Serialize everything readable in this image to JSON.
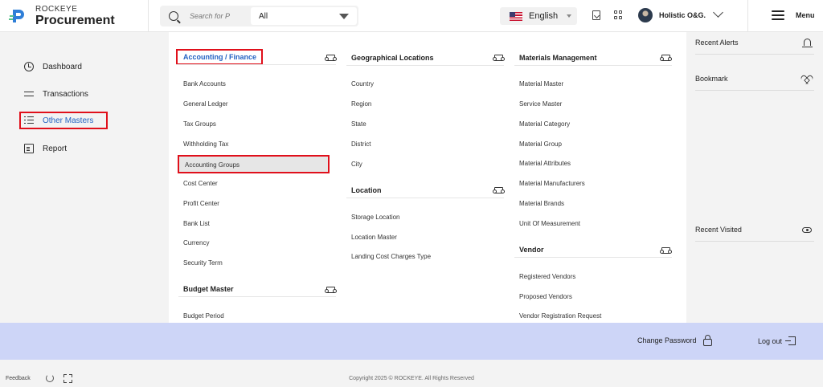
{
  "header": {
    "brand_sub": "ROCKEYE",
    "brand_main": "Procurement",
    "search_placeholder": "Search for P",
    "search_scope": "All",
    "language": "English",
    "user_name": "Holistic O&G.",
    "menu_label": "Menu"
  },
  "sidebar": {
    "items": [
      {
        "label": "Dashboard",
        "icon": "dashboard-icon"
      },
      {
        "label": "Transactions",
        "icon": "transactions-icon"
      },
      {
        "label": "Other Masters",
        "icon": "list-icon",
        "active": true
      },
      {
        "label": "Report",
        "icon": "report-icon"
      }
    ]
  },
  "menu": {
    "accounting": {
      "title": "Accounting / Finance",
      "items": [
        "Bank Accounts",
        "General Ledger",
        "Tax Groups",
        "Withholding Tax",
        "Accounting Groups",
        "Cost Center",
        "Profit Center",
        "Bank List",
        "Currency",
        "Security Term"
      ]
    },
    "budget": {
      "title": "Budget Master",
      "items": [
        "Budget Period"
      ]
    },
    "geo": {
      "title": "Geographical Locations",
      "items": [
        "Country",
        "Region",
        "State",
        "District",
        "City"
      ]
    },
    "location": {
      "title": "Location",
      "items": [
        "Storage Location",
        "Location Master",
        "Landing Cost Charges Type"
      ]
    },
    "materials": {
      "title": "Materials Management",
      "items": [
        "Material Master",
        "Service Master",
        "Material Category",
        "Material Group",
        "Material Attributes",
        "Material Manufacturers",
        "Material Brands",
        "Unit Of Measurement"
      ]
    },
    "vendor": {
      "title": "Vendor",
      "items": [
        "Registered Vendors",
        "Proposed Vendors",
        "Vendor Registration Request"
      ]
    }
  },
  "right_panel": {
    "recent_alerts": "Recent Alerts",
    "bookmark": "Bookmark",
    "recent_visited": "Recent Visited"
  },
  "footer": {
    "change_password": "Change Password",
    "logout": "Log out",
    "feedback": "Feedback",
    "copyright": "Copyright 2025 © ROCKEYE. All Rights Reserved"
  },
  "colors": {
    "accent": "#2362c2",
    "highlight_border": "#e0101b",
    "footer_bar": "#cdd5f7"
  }
}
